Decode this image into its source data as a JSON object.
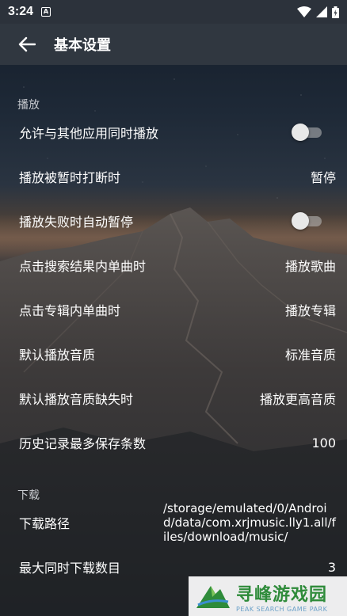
{
  "status_bar": {
    "time": "3:24",
    "notification_glyph": "A",
    "icons": [
      "wifi-icon",
      "signal-icon",
      "battery-icon"
    ]
  },
  "app_bar": {
    "title": "基本设置",
    "back_icon": "arrow-left-icon"
  },
  "sections": {
    "playback": {
      "header": "播放",
      "allow_simultaneous": {
        "label": "允许与其他应用同时播放",
        "enabled": false
      },
      "on_interrupt": {
        "label": "播放被暂时打断时",
        "value": "暂停"
      },
      "auto_pause_on_fail": {
        "label": "播放失败时自动暂停",
        "enabled": false
      },
      "search_single_click": {
        "label": "点击搜索结果内单曲时",
        "value": "播放歌曲"
      },
      "album_single_click": {
        "label": "点击专辑内单曲时",
        "value": "播放专辑"
      },
      "default_quality": {
        "label": "默认播放音质",
        "value": "标准音质"
      },
      "quality_missing": {
        "label": "默认播放音质缺失时",
        "value": "播放更高音质"
      },
      "history_max": {
        "label": "历史记录最多保存条数",
        "value": "100"
      }
    },
    "download": {
      "header": "下载",
      "path": {
        "label": "下载路径",
        "value": "/storage/emulated/0/Android/data/com.xrjmusic.lly1.all/files/download/music/"
      },
      "max_concurrent": {
        "label": "最大同时下载数目",
        "value": "3"
      }
    }
  },
  "watermark": {
    "title": "寻峰游戏园",
    "subtitle": "PEAK SEARCH GAME PARK"
  },
  "colors": {
    "status_bar_bg": "#2c323b",
    "app_bar_bg": "#303740",
    "toggle_track": "#a0a0a0",
    "toggle_thumb": "#e8e8e8",
    "watermark_green": "#2e8b3a"
  }
}
